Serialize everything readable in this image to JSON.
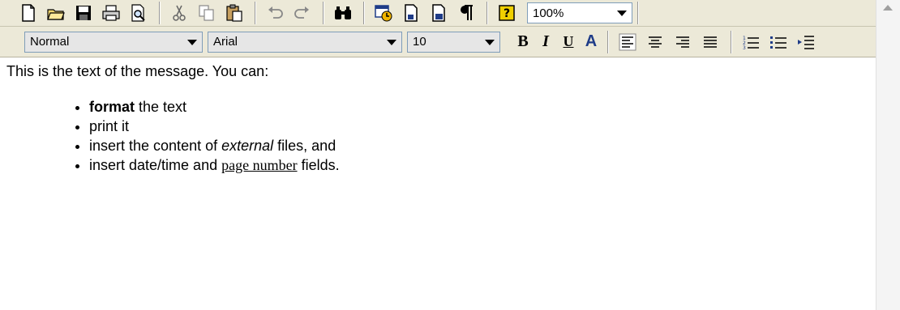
{
  "toolbar1": {
    "buttons": [
      "new-document-icon",
      "open-folder-icon",
      "save-icon",
      "print-icon",
      "print-preview-icon",
      "cut-icon",
      "copy-icon",
      "paste-icon",
      "undo-icon",
      "redo-icon",
      "find-icon",
      "insert-date-time-icon",
      "insert-page-number-icon",
      "insert-page-count-icon",
      "paragraph-marks-icon",
      "help-icon"
    ],
    "zoom": "100%"
  },
  "toolbar2": {
    "style": "Normal",
    "font": "Arial",
    "size": "10",
    "bold": "B",
    "italic": "I",
    "underline": "U",
    "color": "A"
  },
  "content": {
    "intro": "This is the text of the message. You can:",
    "items": [
      {
        "bold": "format",
        "rest": " the text"
      },
      {
        "text": "print it"
      },
      {
        "pre": "insert the content of ",
        "italic": "external",
        "post": " files, and"
      },
      {
        "pre": "insert date/time and ",
        "link": "page number",
        "post": " fields."
      }
    ]
  },
  "colors": {
    "toolbar_bg": "#ece9d8",
    "accent_blue": "#1f3c88"
  }
}
